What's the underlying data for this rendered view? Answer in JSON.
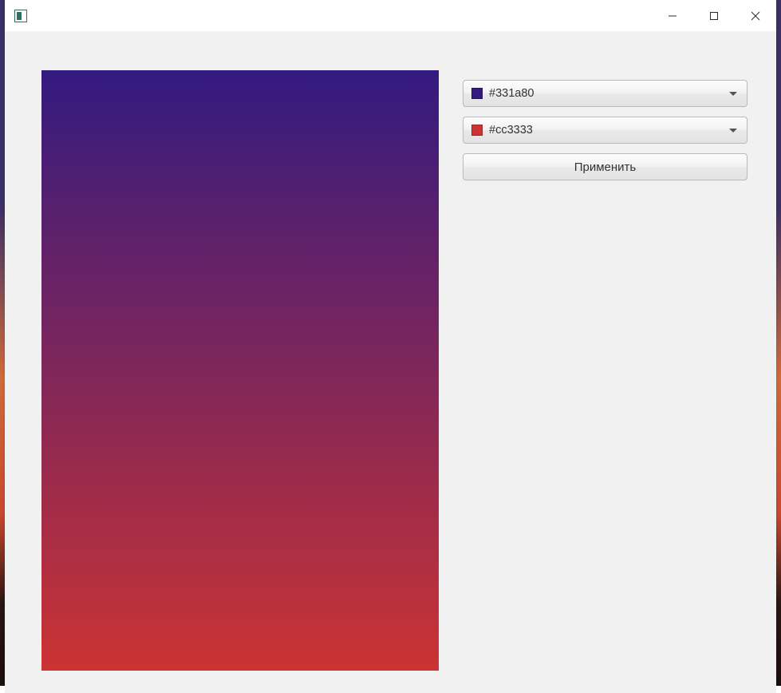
{
  "window": {
    "title": ""
  },
  "colors": {
    "top": {
      "hex": "#331a80",
      "swatch": "#331a80"
    },
    "bottom": {
      "hex": "#cc3333",
      "swatch": "#cc3333"
    }
  },
  "buttons": {
    "apply": "Применить"
  }
}
